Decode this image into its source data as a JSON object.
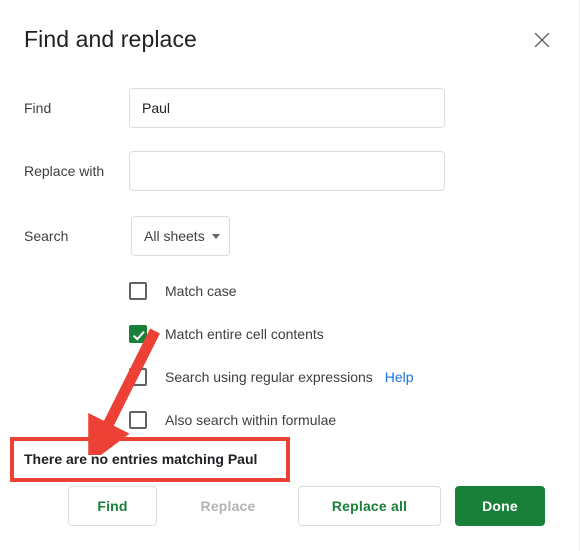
{
  "dialog": {
    "title": "Find and replace",
    "close_icon": "close-icon"
  },
  "fields": {
    "find": {
      "label": "Find",
      "value": "Paul",
      "placeholder": ""
    },
    "replace": {
      "label": "Replace with",
      "value": "",
      "placeholder": ""
    },
    "search": {
      "label": "Search",
      "selected": "All sheets",
      "caret_icon": "chevron-down-icon"
    }
  },
  "options": [
    {
      "label": "Match case",
      "checked": false
    },
    {
      "label": "Match entire cell contents",
      "checked": true
    },
    {
      "label": "Search using regular expressions",
      "checked": false,
      "help_label": "Help"
    },
    {
      "label": "Also search within formulae",
      "checked": false
    }
  ],
  "status": {
    "message": "There are no entries matching Paul"
  },
  "buttons": {
    "find": "Find",
    "replace": "Replace",
    "replace_all": "Replace all",
    "done": "Done"
  },
  "colors": {
    "accent_green": "#188038",
    "link_blue": "#1a73e8",
    "annotation_red": "#ee4136",
    "border_gray": "#dadce0",
    "text_primary": "#202124",
    "text_secondary": "#3c4043",
    "disabled_gray": "#b3b3b3"
  },
  "annotations": {
    "arrow": "red-arrow-pointing-to-status-message",
    "rectangle": "red-highlight-rectangle-around-status-message"
  }
}
